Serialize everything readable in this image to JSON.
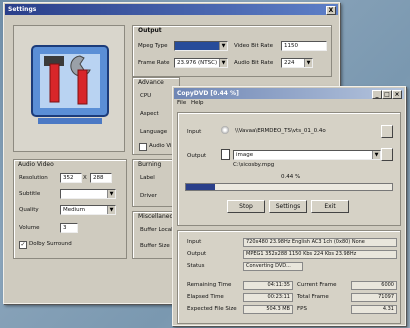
{
  "settings": {
    "title": "Settings",
    "close_glyph": "X",
    "output_group": "Output",
    "mpeg_type_label": "Mpeg Type",
    "frame_rate_label": "Frame Rate",
    "frame_rate_value": "23.976 (NTSC)",
    "video_bitrate_label": "Video Bit Rate",
    "video_bitrate_value": "1150",
    "audio_bitrate_label": "Audio Bit Rate",
    "audio_bitrate_value": "224",
    "advanced_group": "Advance",
    "cpu_label": "CPU",
    "aspect_label": "Aspect",
    "language_label": "Language",
    "audio_vi_label": "Audio Vi",
    "audio_video_group": "Audio Video",
    "resolution_label": "Resolution",
    "res_w": "352",
    "res_x": "X",
    "res_h": "288",
    "subtitle_label": "Subtitle",
    "quality_label": "Quality",
    "quality_value": "Medium",
    "volume_label": "Volume",
    "volume_value": "3",
    "dolby_label": "Dolby Surround",
    "burning_group": "Burning",
    "label_label": "Label",
    "driver_label": "Driver",
    "misc_group": "Miscellaneous",
    "buffer_local_label": "Buffer Local",
    "buffer_size_label": "Buffer Size ("
  },
  "copy": {
    "title": "CopyDVD [0.44 %]",
    "menu": [
      "File",
      "Help"
    ],
    "input_label": "Input",
    "input_value": "\\\\Vavaa\\ERMDEO_TS\\vts_01_0.4o",
    "output_label": "Output",
    "output_value": "image",
    "output_path": "C:\\sicosby.mpg",
    "percent": "0.44 %",
    "progress": 0.0044,
    "stop_button": "Stop",
    "settings_button": "Settings",
    "exit_button": "Exit",
    "info": {
      "input_label": "Input",
      "input_value": "720x480 23.98Hz English AC3 1ch (0x80) None",
      "output_label": "Output",
      "output_value": "MPEG1 352x288 1150 Kbs 224 Kbs 23.98Hz",
      "status_label": "Status",
      "status_value": "Converting DVD..."
    },
    "stats": {
      "remaining_label": "Remaining Time",
      "remaining_value": "04:11:35",
      "elapsed_label": "Elapsed Time",
      "elapsed_value": "00:23:11",
      "expected_label": "Expected File Size",
      "expected_value": "504.3 MB",
      "current_frame_label": "Current Frame",
      "current_frame_value": "6000",
      "total_frame_label": "Total Frame",
      "total_frame_value": "71097",
      "fps_label": "FPS",
      "fps_value": "4.31"
    }
  }
}
